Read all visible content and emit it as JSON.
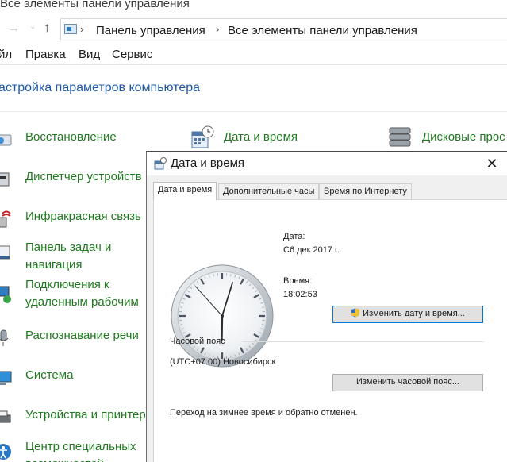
{
  "window": {
    "title": "Все элементы панели управления"
  },
  "address_bar": {
    "breadcrumbs": [
      "Панель управления",
      "Все элементы панели управления"
    ]
  },
  "menu": [
    "йл",
    "Правка",
    "Вид",
    "Сервис"
  ],
  "heading": "астройка параметров компьютера",
  "items": [
    {
      "label": "Восстановление"
    },
    {
      "label": "Дата и время"
    },
    {
      "label": "Дисковые прос"
    },
    {
      "label": "Диспетчер устройств"
    },
    {
      "label": "Инфракрасная связь"
    },
    {
      "line1": "Панель задач и",
      "line2": "навигация"
    },
    {
      "line1": "Подключения к",
      "line2": "удаленным рабочим"
    },
    {
      "label": "Распознавание речи"
    },
    {
      "label": "Система"
    },
    {
      "label": "Устройства и принтеры"
    },
    {
      "line1": "Центр специальных",
      "line2": "возможностей"
    }
  ],
  "dialog": {
    "title": "Дата и время",
    "tabs": [
      "Дата и время",
      "Дополнительные часы",
      "Время по Интернету"
    ],
    "active_tab": 0,
    "date_label": "Дата:",
    "date_value": "С6 дек 2017 г.",
    "time_label": "Время:",
    "time_value": "18:02:53",
    "change_datetime_button": "Изменить дату и время...",
    "timezone_label": "Часовой пояс",
    "timezone_value": "(UTC+07:00) Новосибирск",
    "change_timezone_button": "Изменить часовой пояс...",
    "dst_note": "Переход на зимнее время и обратно отменен.",
    "clock": {
      "hour": 18,
      "minute": 2,
      "second": 53
    }
  },
  "colors": {
    "link_green": "#1f7a1f",
    "heading_blue": "#1e5aa8",
    "accent_blue": "#0078d7"
  }
}
